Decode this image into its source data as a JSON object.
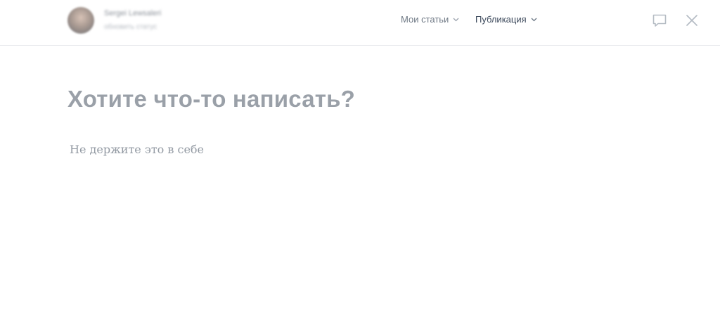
{
  "header": {
    "author": {
      "name": "Sergei Lewsaleri",
      "status": "обновить статус"
    },
    "nav": {
      "my_articles": "Мои статьи",
      "publication": "Публикация"
    },
    "icons": {
      "comment": "comment-icon",
      "close": "close-icon",
      "dropdown": "chevron-down-icon"
    }
  },
  "editor": {
    "title_placeholder": "Хотите что-то написать?",
    "body_placeholder": "Не держите это в себе"
  },
  "colors": {
    "header_border": "#e7e8ec",
    "title": "#9aa0a8",
    "nav_active": "#3d4a5c",
    "nav_inactive": "#6f7985",
    "icon": "#b5bcc4"
  }
}
